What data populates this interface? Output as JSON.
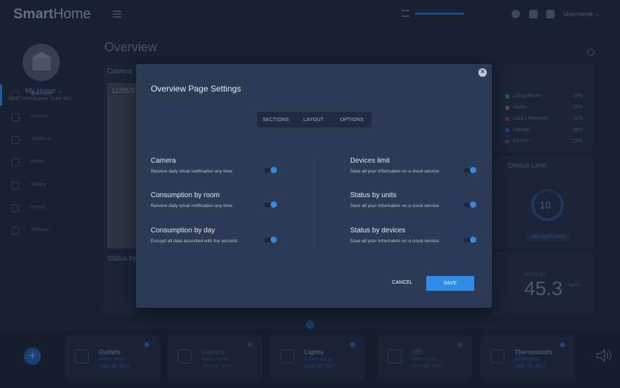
{
  "app": {
    "logo_bold": "Smart",
    "logo_light": "Home",
    "username": "Username",
    "progress_fraction": 1.0,
    "page_title": "Overview"
  },
  "sidebar": {
    "home_name": "My Home",
    "home_address": "5898 Trent Bypass Suite 541",
    "items": [
      {
        "label": "Overview",
        "icon": "home-icon",
        "active": true
      },
      {
        "label": "Devices",
        "icon": "devices-icon",
        "active": false
      },
      {
        "label": "Analytics",
        "icon": "analytics-icon",
        "active": false
      },
      {
        "label": "Rides",
        "icon": "list-icon",
        "active": false
      },
      {
        "label": "Gallery",
        "icon": "gallery-icon",
        "active": false
      },
      {
        "label": "History",
        "icon": "history-icon",
        "active": false
      },
      {
        "label": "Settings",
        "icon": "gear-icon",
        "active": false
      }
    ]
  },
  "background": {
    "camera_title": "Camera",
    "camera_date": "12/05/2",
    "legend": [
      {
        "name": "Living Room",
        "pct": "16%",
        "color": "#1e8a6e"
      },
      {
        "name": "Studio",
        "pct": "22%",
        "color": "#8a6a3a"
      },
      {
        "name": "Luca's Bedroom",
        "pct": "11%",
        "color": "#7a3a3a"
      },
      {
        "name": "Garage",
        "pct": "39%",
        "color": "#1d5ba8"
      },
      {
        "name": "Kitchen",
        "pct": "12%",
        "color": "#3a4a66"
      }
    ],
    "device_limit_title": "Device Limit",
    "device_limit_value": "10",
    "see_more": "SEE MORE INFO",
    "status_title": "Status by",
    "internet_label": "INTERNET",
    "internet_value": "45.3",
    "internet_unit": "MBPS"
  },
  "devices": [
    {
      "name": "Outlets",
      "status": "Active since",
      "date": "June 28, 2017",
      "icon": "plug-icon",
      "active": true
    },
    {
      "name": "Camera",
      "status": "Active since",
      "date": "June 28, 2017",
      "icon": "camera-icon",
      "active": false
    },
    {
      "name": "Lights",
      "status": "Active since",
      "date": "June 28, 2017",
      "icon": "lightbulb-icon",
      "active": true
    },
    {
      "name": "Wifi",
      "status": "Active since",
      "date": "June 28, 2017",
      "icon": "wifi-icon",
      "active": false
    },
    {
      "name": "Thermostats",
      "status": "Active since",
      "date": "June 28, 2017",
      "icon": "thermometer-icon",
      "active": true
    }
  ],
  "modal": {
    "title": "Overview Page Settings",
    "close_icon": "close-icon",
    "tabs": [
      {
        "label": "SECTIONS",
        "active": true
      },
      {
        "label": "LAYOUT",
        "active": false
      },
      {
        "label": "OPTIONS",
        "active": false
      }
    ],
    "left_settings": [
      {
        "title": "Camera",
        "description": "Receive daily email notification any time.",
        "enabled": true
      },
      {
        "title": "Consumption by room",
        "description": "Receive daily email notification any time.",
        "enabled": true
      },
      {
        "title": "Consumption by day",
        "description": "Encrypt all data associted with the account.",
        "enabled": true
      }
    ],
    "right_settings": [
      {
        "title": "Devices limit",
        "description": "Save all your information on a cloud service.",
        "enabled": true
      },
      {
        "title": "Status by units",
        "description": "Save all your information on a cloud service.",
        "enabled": true
      },
      {
        "title": "Status by devices",
        "description": "Save all your information on a cloud service.",
        "enabled": true
      }
    ],
    "cancel_label": "CANCEL",
    "save_label": "SAVE"
  },
  "colors": {
    "accent": "#2f8be8",
    "modal_bg": "#2b3a55",
    "page_bg": "#1c2638"
  }
}
